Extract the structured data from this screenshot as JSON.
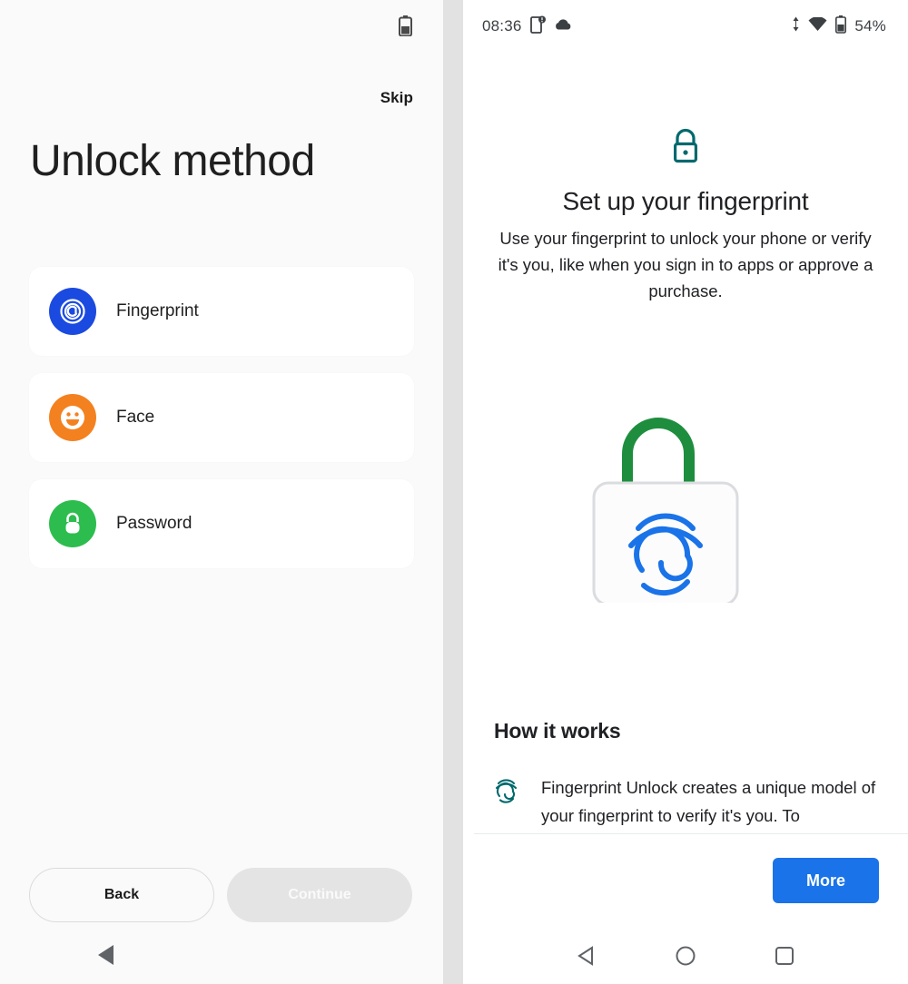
{
  "left_screen": {
    "status_bar": {
      "battery_icon": "battery-icon"
    },
    "skip_label": "Skip",
    "title": "Unlock method",
    "options": [
      {
        "label": "Fingerprint",
        "icon": "fingerprint-icon",
        "color": "#1b4ae0"
      },
      {
        "label": "Face",
        "icon": "face-smile-icon",
        "color": "#f4811f"
      },
      {
        "label": "Password",
        "icon": "lock-icon",
        "color": "#2dbd4e"
      }
    ],
    "buttons": {
      "back": "Back",
      "continue": "Continue"
    },
    "nav_bar": {
      "back_icon": "nav-back-triangle-icon"
    }
  },
  "right_screen": {
    "status_bar": {
      "time": "08:36",
      "phone_icon": "phone-alert-icon",
      "cloud_icon": "cloud-icon",
      "data_icon": "data-transfer-icon",
      "wifi_icon": "wifi-icon",
      "battery_icon": "battery-icon",
      "battery_percent": "54%"
    },
    "header_icon": "lock-icon",
    "title": "Set up your fingerprint",
    "description": "Use your fingerprint to unlock your phone or verify it's you, like when you sign in to apps or approve a purchase.",
    "illustration": {
      "name": "padlock-fingerprint-illustration",
      "shackle_color": "#1e8e3e",
      "fingerprint_color": "#1a73e8"
    },
    "how_it_works": {
      "heading": "How it works",
      "item_icon": "fingerprint-icon",
      "item_text": "Fingerprint Unlock creates a unique model of your fingerprint to verify it's you. To"
    },
    "more_button": "More",
    "nav_bar": {
      "back_icon": "nav-back-triangle-icon",
      "home_icon": "nav-home-circle-icon",
      "recents_icon": "nav-recents-square-icon"
    }
  },
  "colors": {
    "accent_blue": "#1a73e8",
    "teal": "#00696d",
    "green": "#1e8e3e",
    "left_bg": "#fafafa",
    "divider": "#e2e2e2"
  }
}
